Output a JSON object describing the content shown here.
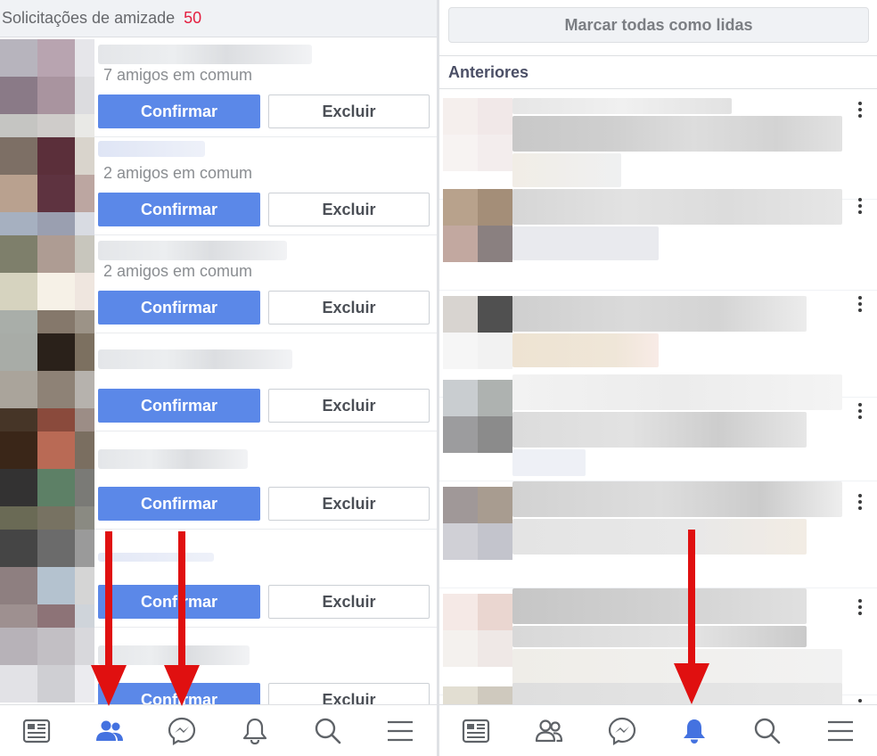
{
  "left": {
    "header": {
      "title": "Solicitações de amizade",
      "count": "50"
    },
    "requests": [
      {
        "mutual": "7 amigos em comum",
        "confirm": "Confirmar",
        "delete": "Excluir"
      },
      {
        "mutual": "2 amigos em comum",
        "confirm": "Confirmar",
        "delete": "Excluir"
      },
      {
        "mutual": "2 amigos em comum",
        "confirm": "Confirmar",
        "delete": "Excluir"
      },
      {
        "mutual": "",
        "confirm": "Confirmar",
        "delete": "Excluir"
      },
      {
        "mutual": "",
        "confirm": "Confirmar",
        "delete": "Excluir"
      },
      {
        "mutual": "",
        "confirm": "Confirmar",
        "delete": "Excluir"
      },
      {
        "mutual": "",
        "confirm": "Confirmar",
        "delete": "Excluir"
      }
    ],
    "nav": [
      "news-feed-icon",
      "friends-icon",
      "messenger-icon",
      "notifications-icon",
      "search-icon",
      "menu-icon"
    ],
    "active_tab": "friends-icon"
  },
  "right": {
    "mark_all": "Marcar todas como lidas",
    "section_title": "Anteriores",
    "nav": [
      "news-feed-icon",
      "friends-icon",
      "messenger-icon",
      "notifications-icon",
      "search-icon",
      "menu-icon"
    ],
    "active_tab": "notifications-icon"
  },
  "colors": {
    "accent": "#5b88e8",
    "active_icon": "#4472e0",
    "inactive_icon": "#5f6368",
    "badge": "#e41e3f",
    "annotation_arrow": "#e01010"
  }
}
